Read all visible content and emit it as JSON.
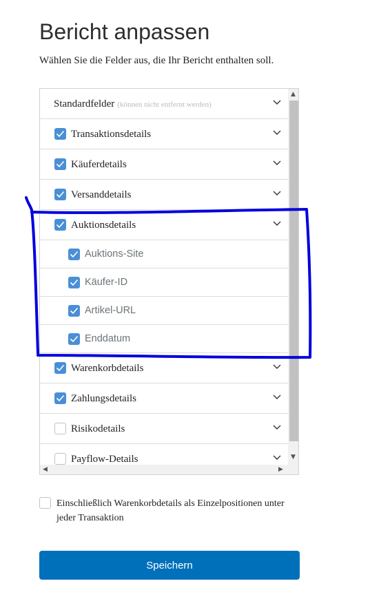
{
  "title": "Bericht anpassen",
  "subtitle": "Wählen Sie die Felder aus, die Ihr Bericht enthalten soll.",
  "standard": {
    "label": "Standardfelder",
    "hint": "(können nicht entfernt werden)"
  },
  "fields": [
    {
      "label": "Transaktionsdetails",
      "checked": true
    },
    {
      "label": "Käuferdetails",
      "checked": true
    },
    {
      "label": "Versanddetails",
      "checked": true
    },
    {
      "label": "Auktionsdetails",
      "checked": true
    },
    {
      "label": "Auktions-Site",
      "checked": true
    },
    {
      "label": "Käufer-ID",
      "checked": true
    },
    {
      "label": "Artikel-URL",
      "checked": true
    },
    {
      "label": "Enddatum",
      "checked": true
    },
    {
      "label": "Warenkorbdetails",
      "checked": true
    },
    {
      "label": "Zahlungsdetails",
      "checked": true
    },
    {
      "label": "Risikodetails",
      "checked": false
    },
    {
      "label": "Payflow-Details",
      "checked": false
    }
  ],
  "include_option": {
    "label": "Einschließlich Warenkorbdetails als Einzelpositionen unter jeder Transaktion",
    "checked": false
  },
  "save_label": "Speichern",
  "colors": {
    "accent": "#0070ba",
    "checkbox": "#4a8fd6",
    "annotation": "#0000dd"
  }
}
